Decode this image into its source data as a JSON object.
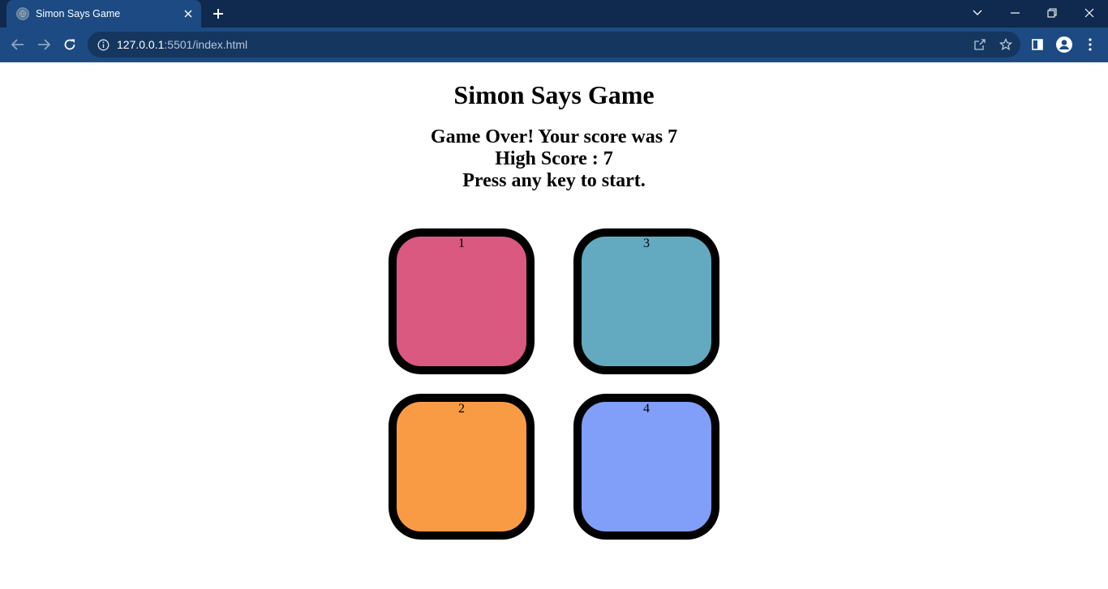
{
  "browser": {
    "tab_title": "Simon Says Game",
    "url_host": "127.0.0.1",
    "url_rest": ":5501/index.html"
  },
  "page": {
    "title": "Simon Says Game",
    "status_lines": [
      "Game Over! Your score was 7",
      "High Score : 7",
      "Press any key to start."
    ]
  },
  "buttons": [
    {
      "label": "1",
      "color": "#d95980"
    },
    {
      "label": "2",
      "color": "#f99b45"
    },
    {
      "label": "3",
      "color": "#63aac0"
    },
    {
      "label": "4",
      "color": "#819ff9"
    }
  ]
}
